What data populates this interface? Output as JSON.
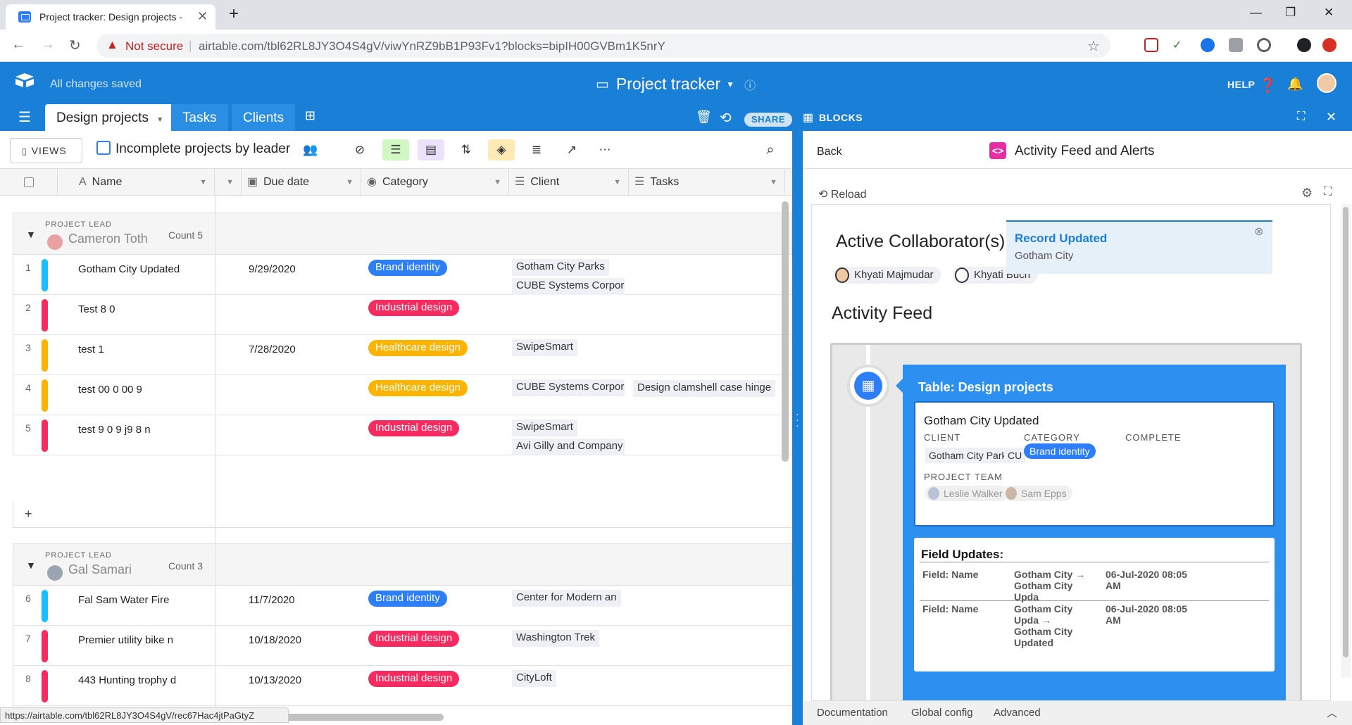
{
  "browser": {
    "tab_title": "Project tracker: Design projects -",
    "not_secure": "Not secure",
    "url": "airtable.com/tbl62RL8JY3O4S4gV/viwYnRZ9bB1P93Fv1?blocks=bipIH00GVBm1K5nrY",
    "status_url": "https://airtable.com/tbl62RL8JY3O4S4gV/rec67Hac4jtPaGtyZ"
  },
  "app": {
    "save_status": "All changes saved",
    "base_title": "Project tracker",
    "help": "HELP",
    "share": "SHARE",
    "blocks": "BLOCKS",
    "tabs": [
      "Design projects",
      "Tasks",
      "Clients"
    ]
  },
  "view": {
    "views_btn": "VIEWS",
    "name": "Incomplete projects by leader"
  },
  "columns": [
    "Name",
    "Due date",
    "Category",
    "Client",
    "Tasks"
  ],
  "groups": [
    {
      "label": "PROJECT LEAD",
      "leader": "Cameron Toth",
      "count": "Count 5",
      "rows": [
        {
          "num": "1",
          "name": "Gotham City Updated",
          "date": "9/29/2020",
          "category": "Brand identity",
          "clients": [
            "Gotham City Parks",
            "CUBE Systems Corpor"
          ],
          "task": ""
        },
        {
          "num": "2",
          "name": "Test 8 0",
          "date": "",
          "category": "Industrial design",
          "clients": [],
          "task": ""
        },
        {
          "num": "3",
          "name": "test 1",
          "date": "7/28/2020",
          "category": "Healthcare design",
          "clients": [
            "SwipeSmart"
          ],
          "task": ""
        },
        {
          "num": "4",
          "name": "test  00 0 00  9",
          "date": "",
          "category": "Healthcare design",
          "clients": [
            "CUBE Systems Corpor"
          ],
          "task": "Design clamshell case hinge"
        },
        {
          "num": "5",
          "name": "test 9  0 9 j9 8 n",
          "date": "",
          "category": "Industrial design",
          "clients": [
            "SwipeSmart",
            "Avi Gilly and Company"
          ],
          "task": ""
        }
      ]
    },
    {
      "label": "PROJECT LEAD",
      "leader": "Gal Samari",
      "count": "Count 3",
      "rows": [
        {
          "num": "6",
          "name": "Fal Sam Water Fire",
          "date": "11/7/2020",
          "category": "Brand identity",
          "clients": [
            "Center for Modern an"
          ],
          "task": ""
        },
        {
          "num": "7",
          "name": "Premier utility bike n",
          "date": "10/18/2020",
          "category": "Industrial design",
          "clients": [
            "Washington Trek"
          ],
          "task": ""
        },
        {
          "num": "8",
          "name": "443 Hunting trophy d",
          "date": "10/13/2020",
          "category": "Industrial design",
          "clients": [
            "CityLoft"
          ],
          "task": ""
        }
      ]
    }
  ],
  "category_colors": {
    "Brand identity": "#2d7ff9",
    "Industrial design": "#f82b60",
    "Healthcare design": "#fcb400"
  },
  "row_bar_colors": [
    "#18bfff",
    "#f82b60",
    "#fcb400",
    "#fcb400",
    "#f82b60",
    "#18bfff",
    "#f82b60",
    "#f82b60"
  ],
  "block": {
    "back": "Back",
    "name": "Activity Feed and Alerts",
    "reload": "Reload",
    "active_collaborators": "Active Collaborator(s)",
    "collaborators": [
      "Khyati Majmudar",
      "Khyati Buch"
    ],
    "alert_title": "Record Updated",
    "alert_sub": "Gotham City",
    "activity_feed": "Activity Feed",
    "card_header": "Table: Design projects",
    "record_name": "Gotham City Updated",
    "client_label": "CLIENT",
    "category_label": "CATEGORY",
    "complete_label": "COMPLETE",
    "client_chips": [
      "Gotham City Parks",
      "CU"
    ],
    "category_value": "Brand identity",
    "team_label": "PROJECT TEAM",
    "team": [
      "Leslie Walker",
      "Sam Epps"
    ],
    "field_updates_title": "Field Updates:",
    "updates": [
      {
        "field": "Field: Name",
        "from": "Gotham City",
        "to": "Gotham City Upda",
        "time": "06-Jul-2020 08:05 AM"
      },
      {
        "field": "Field: Name",
        "from": "Gotham City Upda",
        "to": "Gotham City Updated",
        "time": "06-Jul-2020 08:05 AM"
      }
    ],
    "footer": [
      "Documentation",
      "Global config",
      "Advanced"
    ]
  }
}
